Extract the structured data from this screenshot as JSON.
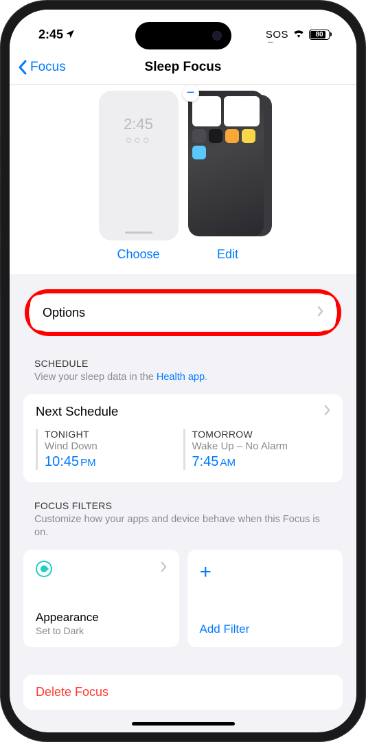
{
  "statusBar": {
    "time": "2:45",
    "sos": "SOS",
    "battery": "80"
  },
  "nav": {
    "back": "Focus",
    "title": "Sleep Focus"
  },
  "screens": {
    "lockTime": "2:45",
    "lockDots": "○○○",
    "choose": "Choose",
    "edit": "Edit"
  },
  "options": {
    "label": "Options"
  },
  "schedule": {
    "header": "SCHEDULE",
    "desc": "View your sleep data in the ",
    "link": "Health app",
    "suffix": ".",
    "next": "Next Schedule",
    "tonight": {
      "label": "TONIGHT",
      "sub": "Wind Down",
      "time": "10:45",
      "ampm": "PM"
    },
    "tomorrow": {
      "label": "TOMORROW",
      "sub": "Wake Up – No Alarm",
      "time": "7:45",
      "ampm": "AM"
    }
  },
  "filters": {
    "header": "FOCUS FILTERS",
    "desc": "Customize how your apps and device behave when this Focus is on.",
    "appearance": {
      "name": "Appearance",
      "value": "Set to Dark"
    },
    "add": "Add Filter"
  },
  "delete": "Delete Focus"
}
